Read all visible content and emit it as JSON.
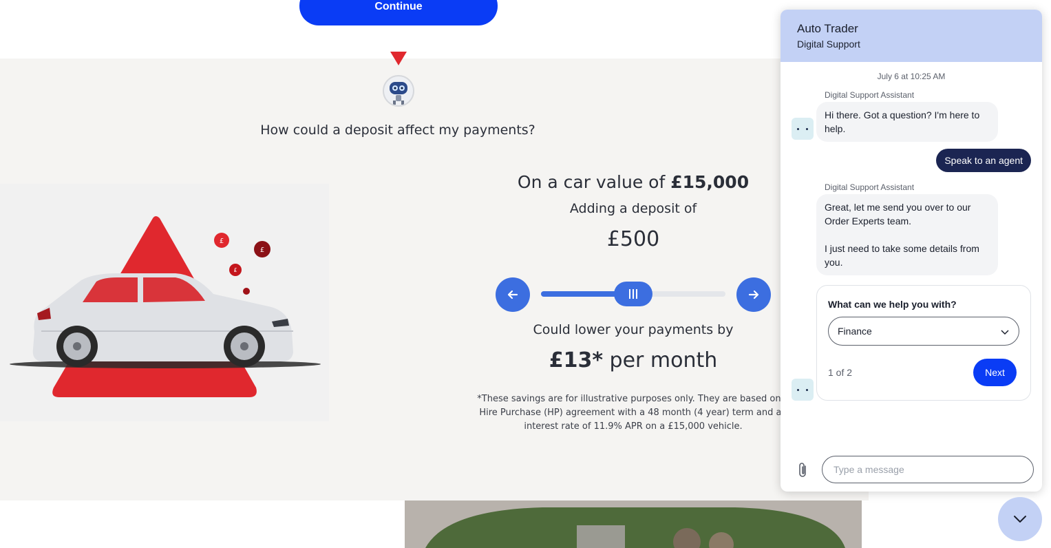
{
  "page": {
    "continue_label": "Continue",
    "question": "How could a deposit affect my payments?"
  },
  "calculator": {
    "car_value_prefix": "On a car value of ",
    "car_value": "£15,000",
    "adding_label": "Adding a deposit of",
    "deposit_value": "£500",
    "slider_fraction": 0.5,
    "lower_label": "Could lower your payments by",
    "saving_value": "£13*",
    "saving_suffix": " per month",
    "disclaimer": "*These savings are for illustrative purposes only. They are based on a Hire Purchase (HP) agreement with a 48 month (4 year) term and an interest rate of 11.9% APR on a £15,000 vehicle.",
    "accent_color": "#3c6ee0"
  },
  "chat": {
    "title": "Auto Trader",
    "subtitle": "Digital Support",
    "timestamp": "July 6 at 10:25 AM",
    "messages": [
      {
        "sender": "Digital Support Assistant",
        "text": "Hi there. Got a question? I'm here to help."
      },
      {
        "sender": "user",
        "text": "Speak to an agent"
      },
      {
        "sender": "Digital Support Assistant",
        "text": "Great, let me send you over to our Order Experts team.\n\nI just need to take some details from you."
      }
    ],
    "form": {
      "question": "What can we help you with?",
      "selected": "Finance",
      "step": "1 of 2",
      "next_label": "Next"
    },
    "input_placeholder": "Type a message",
    "brand_color": "#0a3cf5",
    "header_color": "#c3d1f5"
  }
}
